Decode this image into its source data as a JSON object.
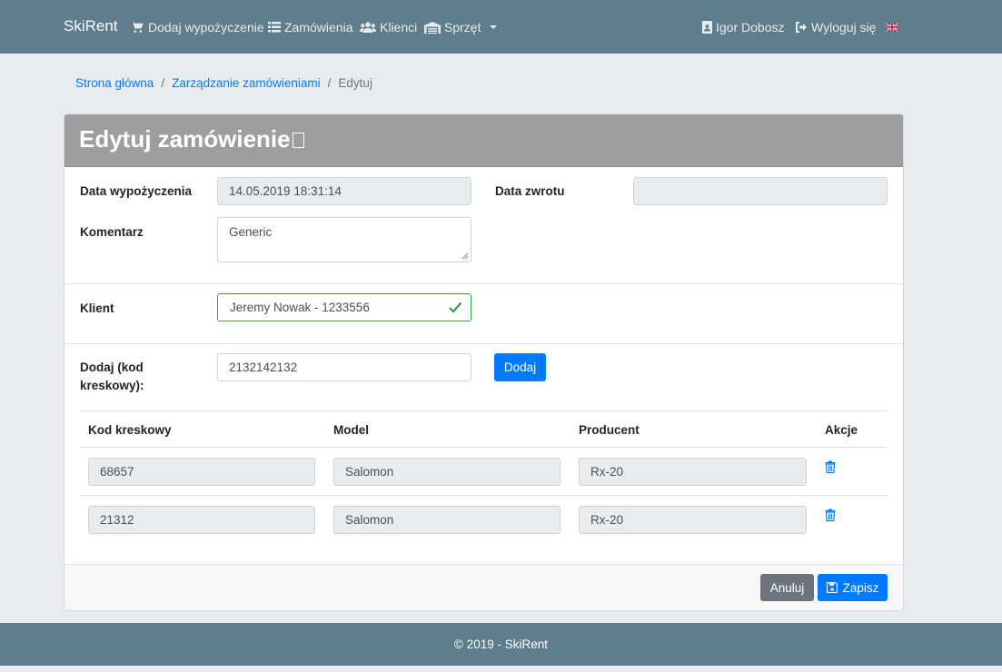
{
  "navbar": {
    "brand": "SkiRent",
    "items": [
      {
        "label": "Dodaj wypożyczenie",
        "icon": "cart-icon"
      },
      {
        "label": "Zamówienia",
        "icon": "list-icon"
      },
      {
        "label": "Klienci",
        "icon": "users-icon"
      },
      {
        "label": "Sprzęt",
        "icon": "warehouse-icon"
      }
    ],
    "user": {
      "label": "Igor Dobosz",
      "icon": "id-badge-icon"
    },
    "logout": {
      "label": "Wyloguj się",
      "icon": "sign-out-icon"
    },
    "language_icon": "uk-flag-icon"
  },
  "breadcrumb": {
    "home": "Strona główna",
    "orders": "Zarządzanie zamówieniami",
    "current": "Edytuj"
  },
  "card": {
    "title": "Edytuj zamówienie",
    "rental_date_label": "Data wypożyczenia",
    "rental_date_value": "14.05.2019 18:31:14",
    "return_date_label": "Data zwrotu",
    "return_date_value": "",
    "comment_label": "Komentarz",
    "comment_value": "Generic",
    "client_label": "Klient",
    "client_value": "Jeremy Nowak - 1233556",
    "add_label": "Dodaj (kod kreskowy):",
    "add_value": "2132142132",
    "add_button": "Dodaj"
  },
  "table": {
    "headers": [
      "Kod kreskowy",
      "Model",
      "Producent",
      "Akcje"
    ],
    "rows": [
      {
        "barcode": "68657",
        "model": "Salomon",
        "producer": "Rx-20"
      },
      {
        "barcode": "21312",
        "model": "Salomon",
        "producer": "Rx-20"
      }
    ]
  },
  "footer_buttons": {
    "cancel": "Anuluj",
    "save": "Zapisz"
  },
  "footer": "© 2019 - SkiRent",
  "colors": {
    "navbar": "#607d8b",
    "primary": "#007bff",
    "secondary": "#6c757d",
    "header": "#9e9e9e",
    "valid": "#28a745"
  }
}
